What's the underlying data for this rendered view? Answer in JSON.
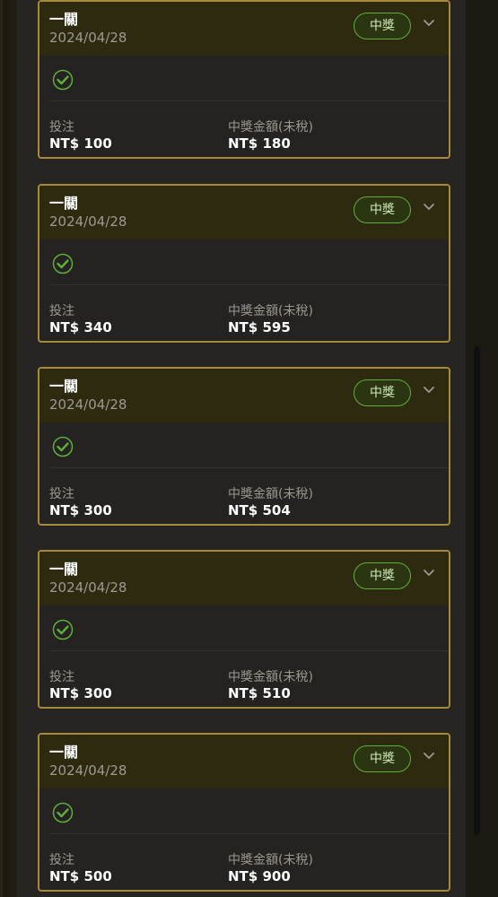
{
  "cards": [
    {
      "title": "一關",
      "date": "2024/04/28",
      "status": "中獎",
      "bet_label": "投注",
      "bet_value": "NT$ 100",
      "win_label": "中獎金額(未稅)",
      "win_value": "NT$ 180"
    },
    {
      "title": "一關",
      "date": "2024/04/28",
      "status": "中獎",
      "bet_label": "投注",
      "bet_value": "NT$ 340",
      "win_label": "中獎金額(未稅)",
      "win_value": "NT$ 595"
    },
    {
      "title": "一關",
      "date": "2024/04/28",
      "status": "中獎",
      "bet_label": "投注",
      "bet_value": "NT$ 300",
      "win_label": "中獎金額(未稅)",
      "win_value": "NT$ 504"
    },
    {
      "title": "一關",
      "date": "2024/04/28",
      "status": "中獎",
      "bet_label": "投注",
      "bet_value": "NT$ 300",
      "win_label": "中獎金額(未稅)",
      "win_value": "NT$ 510"
    },
    {
      "title": "一關",
      "date": "2024/04/28",
      "status": "中獎",
      "bet_label": "投注",
      "bet_value": "NT$ 500",
      "win_label": "中獎金額(未稅)",
      "win_value": "NT$ 900"
    }
  ],
  "icons": {
    "status": "check-circle-icon",
    "expand": "chevron-down-icon"
  },
  "colors": {
    "card_border": "#a68a3a",
    "card_header": "#2e2a10",
    "win_badge_border": "#5fae3a",
    "win_badge_text": "#cfe9b8",
    "check_green": "#5fae3a"
  }
}
